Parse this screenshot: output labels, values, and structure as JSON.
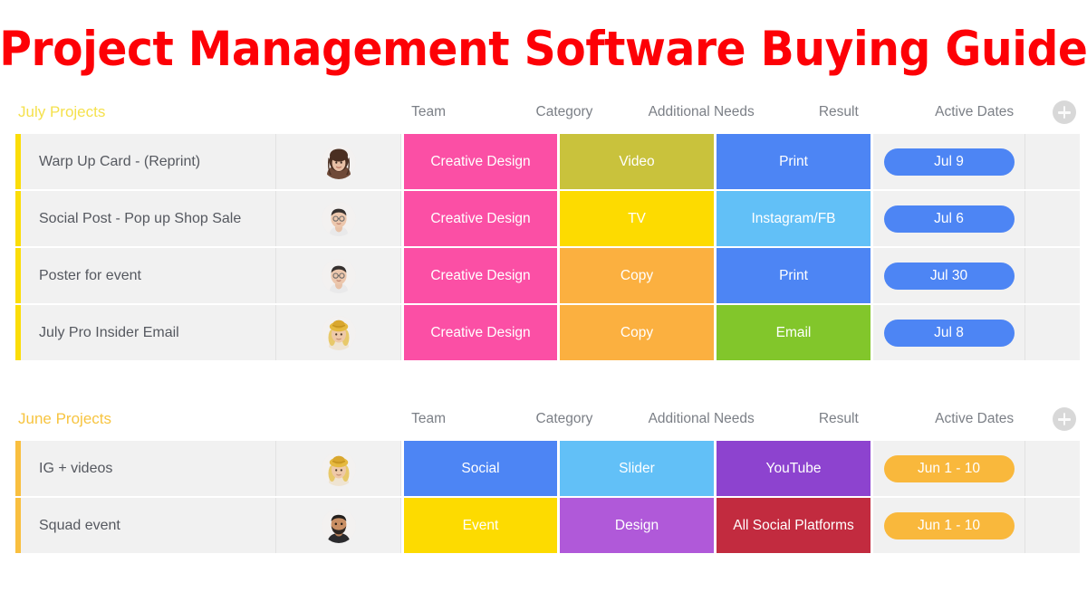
{
  "title": "Project Management Software Buying Guide",
  "title_color": "#fd0006",
  "columns": [
    "Team",
    "Category",
    "Additional Needs",
    "Result",
    "Active Dates"
  ],
  "add_button_icon": "plus-icon",
  "sections": [
    {
      "name": "July Projects",
      "name_color": "#f5e14d",
      "accent_color": "#fbdd08",
      "columns": [
        "Team",
        "Category",
        "Additional Needs",
        "Result",
        "Active Dates"
      ],
      "rows": [
        {
          "task": "Warp Up Card - (Reprint)",
          "avatar": "avatar-woman-brown-hair",
          "category": {
            "label": "Creative Design",
            "color": "#fb4fa5"
          },
          "needs": {
            "label": "Video",
            "color": "#c9c23c"
          },
          "result": {
            "label": "Print",
            "color": "#4d85f4"
          },
          "date": {
            "label": "Jul 9",
            "color": "#4d85f4"
          }
        },
        {
          "task": "Social Post - Pop up Shop Sale",
          "avatar": "avatar-woman-glasses",
          "category": {
            "label": "Creative Design",
            "color": "#fb4fa5"
          },
          "needs": {
            "label": "TV",
            "color": "#fddb00"
          },
          "result": {
            "label": "Instagram/FB",
            "color": "#62c0f7"
          },
          "date": {
            "label": "Jul 6",
            "color": "#4d85f4"
          }
        },
        {
          "task": "Poster for event",
          "avatar": "avatar-woman-glasses",
          "category": {
            "label": "Creative Design",
            "color": "#fb4fa5"
          },
          "needs": {
            "label": "Copy",
            "color": "#fbb040"
          },
          "result": {
            "label": "Print",
            "color": "#4d85f4"
          },
          "date": {
            "label": "Jul 30",
            "color": "#4d85f4"
          }
        },
        {
          "task": "July Pro Insider Email",
          "avatar": "avatar-woman-blonde-hat",
          "category": {
            "label": "Creative Design",
            "color": "#fb4fa5"
          },
          "needs": {
            "label": "Copy",
            "color": "#fbb040"
          },
          "result": {
            "label": "Email",
            "color": "#82c62b"
          },
          "date": {
            "label": "Jul 8",
            "color": "#4d85f4"
          }
        }
      ]
    },
    {
      "name": "June Projects",
      "name_color": "#f7c440",
      "accent_color": "#f9bf3f",
      "columns": [
        "Team",
        "Category",
        "Additional Needs",
        "Result",
        "Active Dates"
      ],
      "rows": [
        {
          "task": "IG + videos",
          "avatar": "avatar-woman-blonde-hat",
          "category": {
            "label": "Social",
            "color": "#4d85f4"
          },
          "needs": {
            "label": "Slider",
            "color": "#62c0f7"
          },
          "result": {
            "label": "YouTube",
            "color": "#8d43cf"
          },
          "date": {
            "label": "Jun 1 - 10",
            "color": "#f9b83c"
          }
        },
        {
          "task": "Squad event",
          "avatar": "avatar-man-beard",
          "category": {
            "label": "Event",
            "color": "#fddb00"
          },
          "needs": {
            "label": "Design",
            "color": "#b059d9"
          },
          "result": {
            "label": "All Social Platforms",
            "color": "#c22b3f"
          },
          "date": {
            "label": "Jun 1 - 10",
            "color": "#f9b83c"
          }
        }
      ]
    }
  ]
}
